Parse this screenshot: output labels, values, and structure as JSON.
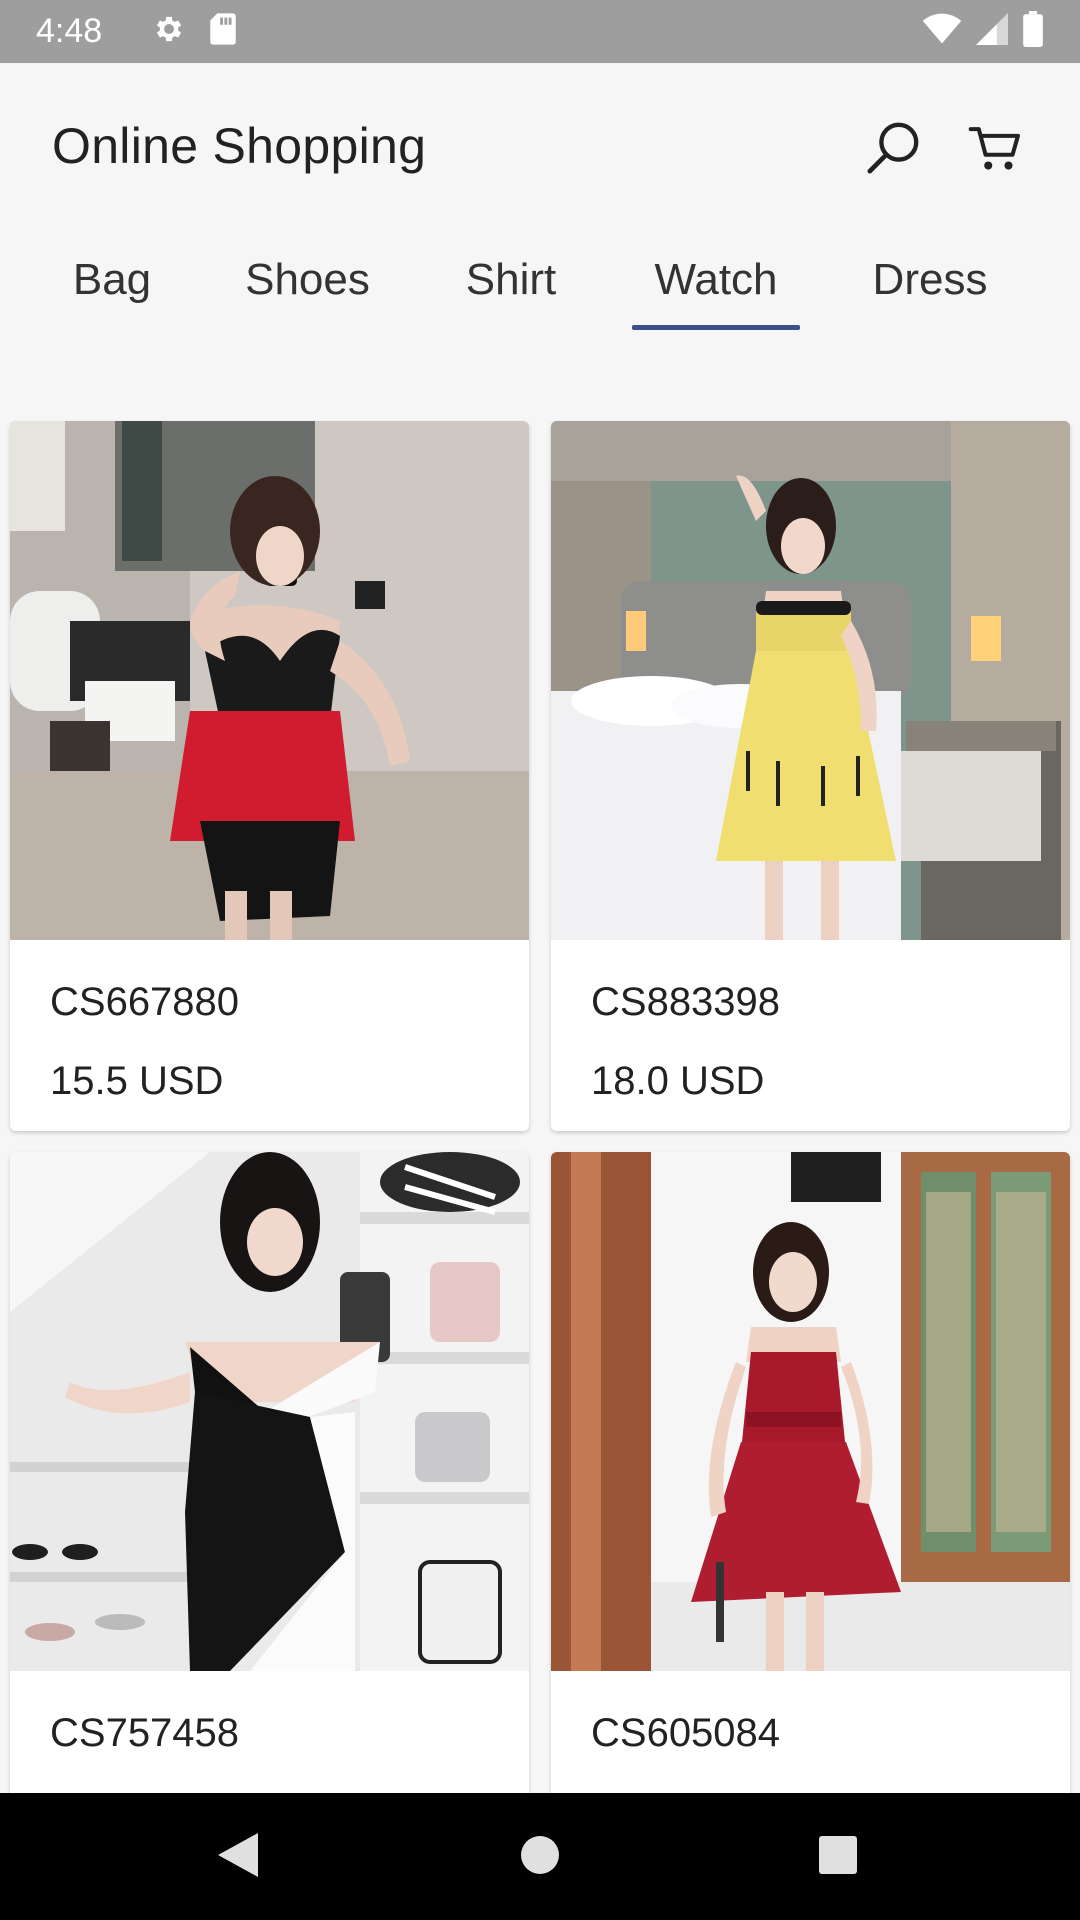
{
  "status": {
    "time": "4:48",
    "icons": [
      "gear-icon",
      "sd-card-icon",
      "wifi-icon",
      "signal-icon",
      "battery-icon"
    ]
  },
  "app": {
    "title": "Online Shopping",
    "actions": [
      "search-icon",
      "cart-icon"
    ]
  },
  "tabs": [
    {
      "label": "Bag",
      "active": false
    },
    {
      "label": "Shoes",
      "active": false
    },
    {
      "label": "Shirt",
      "active": false
    },
    {
      "label": "Watch",
      "active": true
    },
    {
      "label": "Dress",
      "active": false
    }
  ],
  "products": [
    {
      "code": "CS667880",
      "price": "15.5 USD"
    },
    {
      "code": "CS883398",
      "price": "18.0 USD"
    },
    {
      "code": "CS757458",
      "price": ""
    },
    {
      "code": "CS605084",
      "price": ""
    }
  ],
  "colors": {
    "accent": "#3c4f8c",
    "status_bar": "#9e9e9e",
    "background": "#f6f6f6"
  }
}
